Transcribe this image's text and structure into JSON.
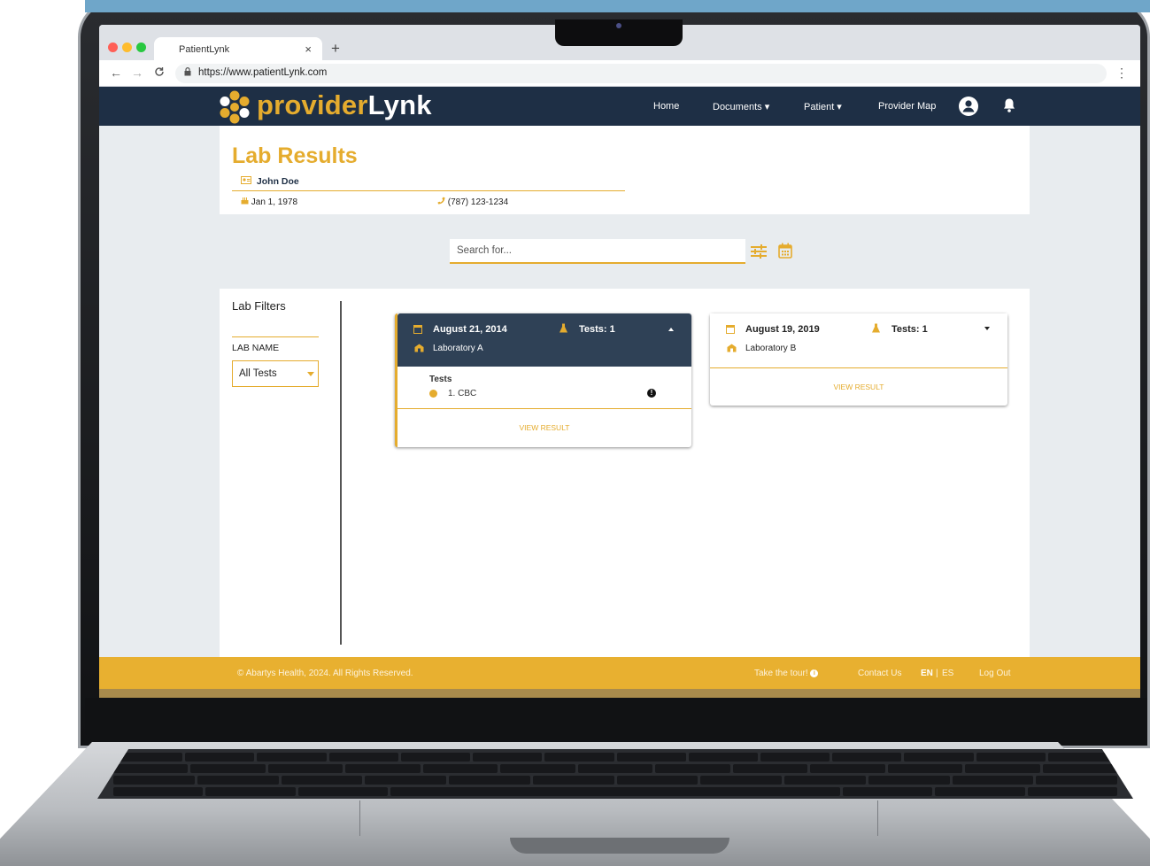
{
  "browser": {
    "tab_title": "PatientLynk",
    "tab_close": "×",
    "new_tab": "+",
    "url": "https://www.patientLynk.com",
    "back": "←",
    "forward": "→",
    "reload": "C",
    "menu": "⋮"
  },
  "nav": {
    "logo_provider": "provider",
    "logo_lynk": "Lynk",
    "links": [
      "Home",
      "Documents ▾",
      "Patient ▾",
      "Provider Map"
    ],
    "icons": [
      "user-avatar-icon",
      "bell-icon"
    ]
  },
  "header": {
    "title": "Lab Results",
    "patient_name": "John Doe",
    "dob": "Jan 1, 1978",
    "phone": "(787) 123-1234"
  },
  "search": {
    "placeholder": "Search for..."
  },
  "filters": {
    "title": "Lab Filters",
    "lab_name_label": "LAB NAME",
    "lab_name_value": "All Tests"
  },
  "cards": [
    {
      "date": "August 21, 2014",
      "tests": "Tests: 1",
      "lab": "Laboratory A",
      "expanded": true,
      "tests_heading": "Tests",
      "test_items": [
        "1. CBC"
      ],
      "view_result": "VIEW RESULT"
    },
    {
      "date": "August 19, 2019",
      "tests": "Tests: 1",
      "lab": "Laboratory B",
      "expanded": false,
      "view_result": "VIEW RESULT"
    }
  ],
  "footer": {
    "copyright": "© Abartys Health, 2024. All Rights Reserved.",
    "tour": "Take the tour!",
    "contact": "Contact Us",
    "lang_en": "EN",
    "lang_sep": "|",
    "lang_es": "ES",
    "logout": "Log Out"
  },
  "colors": {
    "brand_gold": "#e5ac2e",
    "navy": "#1e2f45",
    "card_head": "#2f4156",
    "footer": "#e8b030"
  }
}
